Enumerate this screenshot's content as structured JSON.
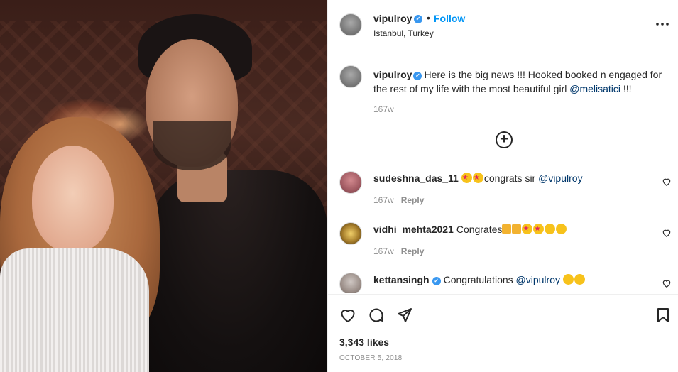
{
  "post": {
    "author": "vipulroy",
    "follow_label": "Follow",
    "separator": "•",
    "location": "Istanbul, Turkey",
    "verified_mark": "✓"
  },
  "caption": {
    "username": "vipulroy",
    "text": "Here is the big news !!! Hooked booked n engaged for the rest of my life with the most beautiful girl ",
    "mention": "@melisatici",
    "suffix": " !!!",
    "time": "167w"
  },
  "load_more": "+",
  "comments": [
    {
      "username": "sudeshna_das_11",
      "text": "congrats sir ",
      "mention": "@vipulroy",
      "time": "167w",
      "reply_label": "Reply"
    },
    {
      "username": "vidhi_mehta2021",
      "text": "Congrates",
      "time": "167w",
      "reply_label": "Reply"
    },
    {
      "username": "kettansingh",
      "text": "Congratulations ",
      "mention": "@vipulroy",
      "time": "",
      "reply_label": ""
    }
  ],
  "likes": "3,343 likes",
  "date": "OCTOBER 5, 2018",
  "icons": [
    "like-icon",
    "comment-icon",
    "share-icon",
    "save-icon",
    "more-options-icon"
  ],
  "colors": {
    "link_blue": "#0095f6",
    "verified_blue": "#3897f0",
    "mention_blue": "#00376b",
    "muted": "#8e8e8e"
  }
}
